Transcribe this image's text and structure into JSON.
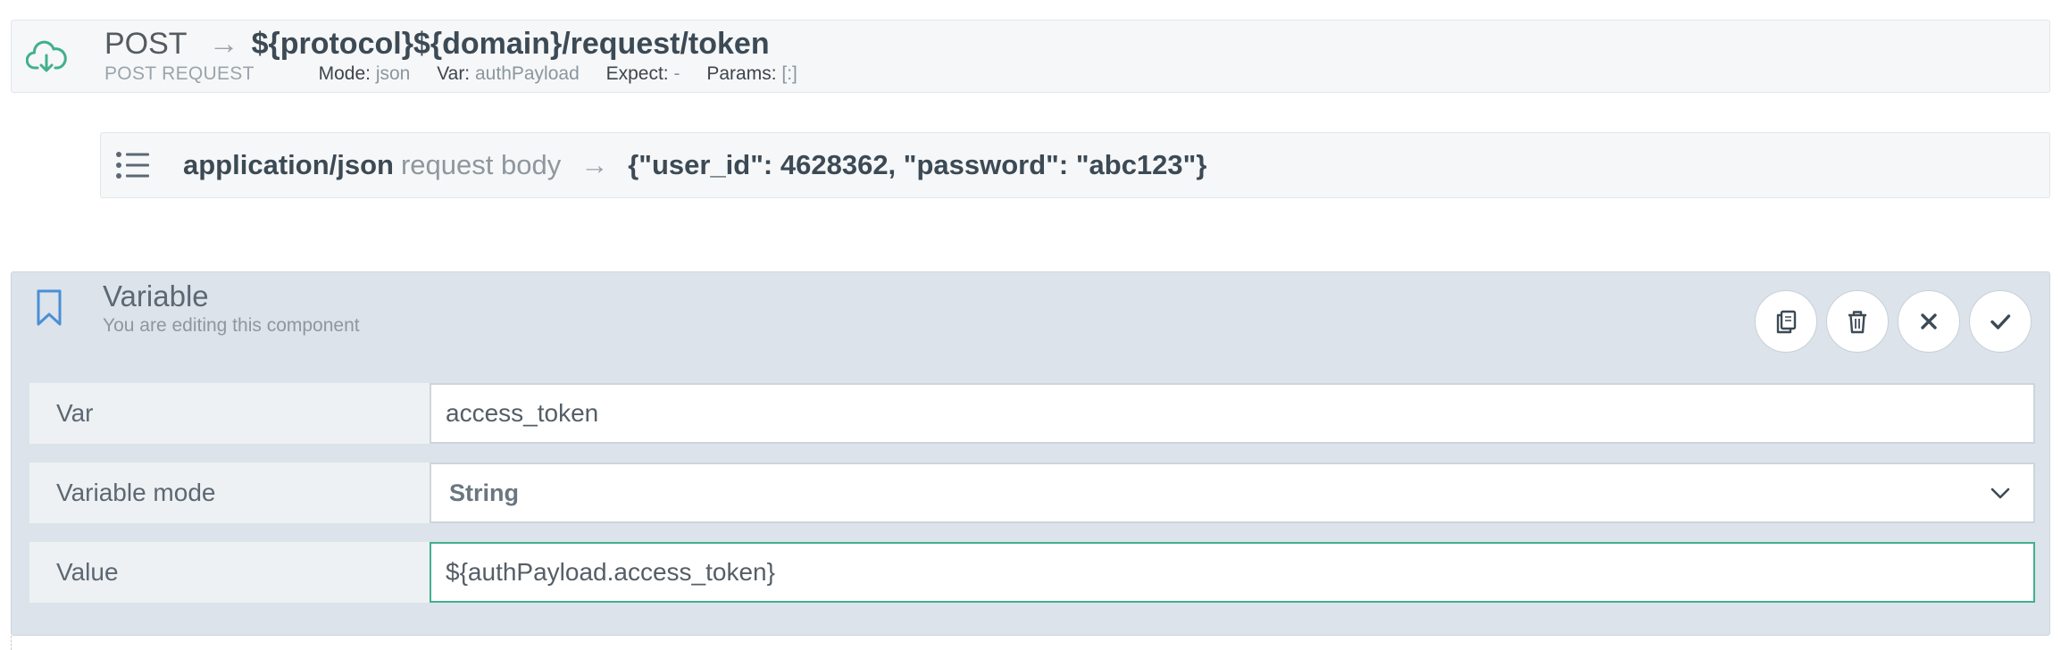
{
  "post_step": {
    "icon": "cloud-download-icon",
    "method": "POST",
    "arrow": "→",
    "url": "${protocol}${domain}/request/token",
    "type_label": "POST REQUEST",
    "mode_label": "Mode:",
    "mode_value": "json",
    "var_label": "Var:",
    "var_value": "authPayload",
    "expect_label": "Expect:",
    "expect_value": "-",
    "params_label": "Params:",
    "params_value": "[:]"
  },
  "request_body": {
    "icon": "list-icon",
    "content_type": "application/json",
    "description": "request body",
    "arrow": "→",
    "json": "{\"user_id\": 4628362, \"password\": \"abc123\"}"
  },
  "variable_editor": {
    "icon": "bookmark-icon",
    "title": "Variable",
    "subtitle": "You are editing this component",
    "actions": [
      "copy-icon",
      "trash-icon",
      "close-icon",
      "check-icon"
    ],
    "fields": {
      "var": {
        "label": "Var",
        "value": "access_token"
      },
      "mode": {
        "label": "Variable mode",
        "value": "String"
      },
      "value": {
        "label": "Value",
        "value": "${authPayload.access_token}"
      }
    }
  },
  "colors": {
    "accent_green": "#41b08c",
    "accent_blue": "#4a8fd6",
    "panel_bg": "#dce3ea"
  }
}
